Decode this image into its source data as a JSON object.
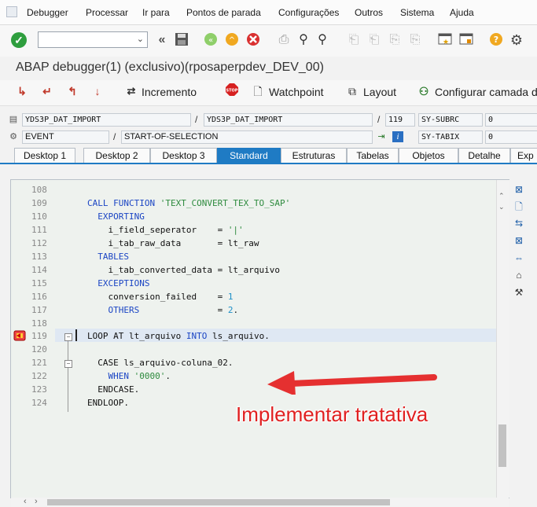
{
  "menu": {
    "items": [
      "Debugger",
      "Processar",
      "Ir para",
      "Pontos de parada",
      "Configurações",
      "Outros",
      "Sistema",
      "Ajuda"
    ]
  },
  "toolbar": {
    "command_field_value": "",
    "icons": [
      "enter-icon",
      "back-icon",
      "save-icon",
      "nav-back-icon",
      "nav-exit-icon",
      "cancel-icon",
      "print-icon",
      "find-icon",
      "find-next-icon",
      "first-page-icon",
      "prev-page-icon",
      "next-page-icon",
      "last-page-icon",
      "new-session-icon",
      "shortcut-icon",
      "help-icon",
      "settings-icon"
    ]
  },
  "title": "ABAP debugger(1)  (exclusivo)(rposaperpdev_DEV_00)",
  "app_toolbar": {
    "incremento": "Incremento",
    "watchpoint": "Watchpoint",
    "layout": "Layout",
    "configurar": "Configurar camada d"
  },
  "status": {
    "row1": {
      "program": "YDS3P_DAT_IMPORT",
      "include": "YDS3P_DAT_IMPORT",
      "line": "119",
      "var_name": "SY-SUBRC",
      "var_value": "0"
    },
    "row2": {
      "type": "EVENT",
      "event": "START-OF-SELECTION",
      "var_name": "SY-TABIX",
      "var_value": "0"
    }
  },
  "tabs": [
    "Desktop 1",
    "Desktop 2",
    "Desktop 3",
    "Standard",
    "Estruturas",
    "Tabelas",
    "Objetos",
    "Detalhe",
    "Exp"
  ],
  "active_tab": "Standard",
  "code": {
    "lines": [
      {
        "n": "108",
        "text": ""
      },
      {
        "n": "109",
        "text": "CALL FUNCTION 'TEXT_CONVERT_TEX_TO_SAP'"
      },
      {
        "n": "110",
        "text": "  EXPORTING"
      },
      {
        "n": "111",
        "text": "    i_field_seperator    = '|'"
      },
      {
        "n": "112",
        "text": "    i_tab_raw_data       = lt_raw"
      },
      {
        "n": "113",
        "text": "  TABLES"
      },
      {
        "n": "114",
        "text": "    i_tab_converted_data = lt_arquivo"
      },
      {
        "n": "115",
        "text": "  EXCEPTIONS"
      },
      {
        "n": "116",
        "text": "    conversion_failed    = 1"
      },
      {
        "n": "117",
        "text": "    OTHERS               = 2."
      },
      {
        "n": "118",
        "text": ""
      },
      {
        "n": "119",
        "text": "LOOP AT lt_arquivo INTO ls_arquivo."
      },
      {
        "n": "120",
        "text": ""
      },
      {
        "n": "121",
        "text": "  CASE ls_arquivo-coluna_02."
      },
      {
        "n": "122",
        "text": "    WHEN '0000'."
      },
      {
        "n": "123",
        "text": "  ENDCASE."
      },
      {
        "n": "124",
        "text": "ENDLOOP."
      }
    ],
    "current_line": "119"
  },
  "annotation": "Implementar tratativa",
  "colors": {
    "accent": "#1f7bc4",
    "annotation": "#e02020",
    "keyword": "#1b45c4",
    "string": "#2e8b3e"
  }
}
